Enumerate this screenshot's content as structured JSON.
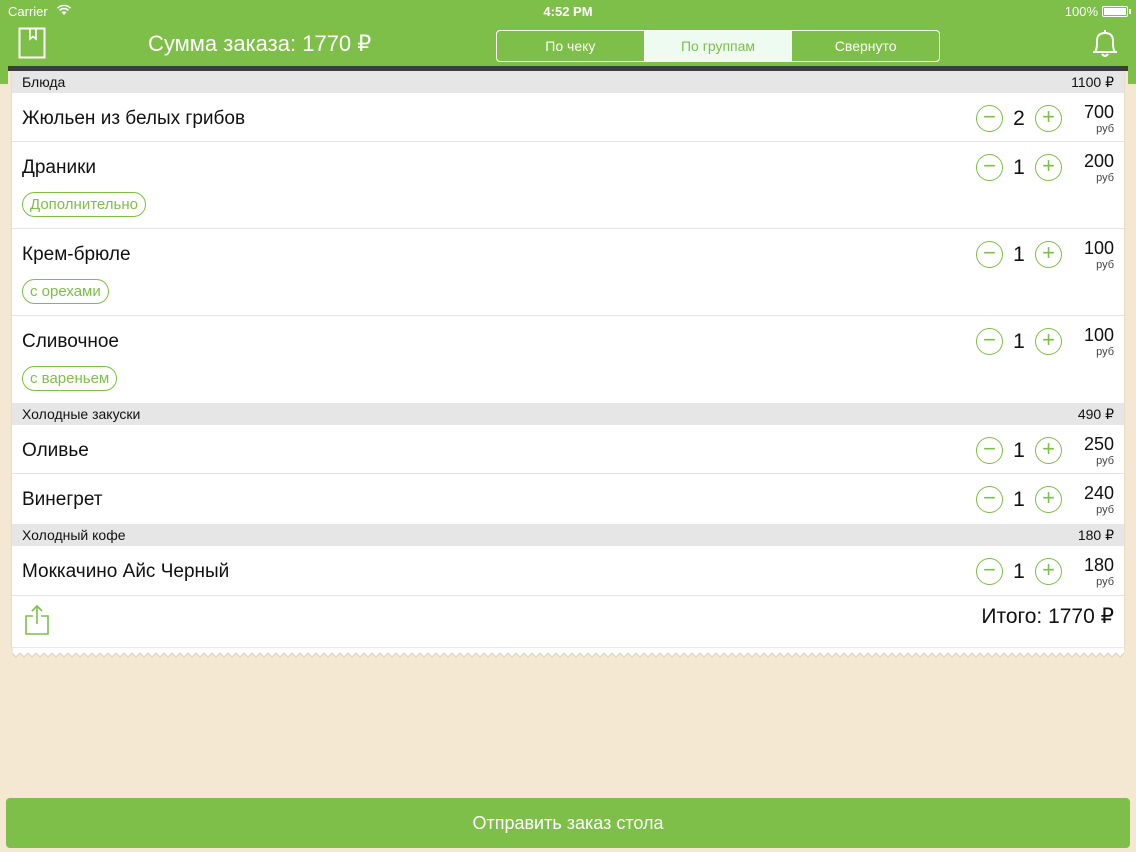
{
  "status_bar": {
    "carrier": "Carrier",
    "time": "4:52 PM",
    "battery": "100%"
  },
  "header": {
    "title": "Сумма заказа: 1770 ₽",
    "segments": [
      {
        "label": "По чеку",
        "active": false
      },
      {
        "label": "По группам",
        "active": true
      },
      {
        "label": "Свернуто",
        "active": false
      }
    ]
  },
  "groups": [
    {
      "name": "Блюда",
      "sum": "1100 ₽",
      "items": [
        {
          "name": "Жюльен из белых грибов",
          "qty": "2",
          "price": "700",
          "unit": "руб",
          "tag": ""
        },
        {
          "name": "Драники",
          "qty": "1",
          "price": "200",
          "unit": "руб",
          "tag": "Дополнительно"
        },
        {
          "name": "Крем-брюле",
          "qty": "1",
          "price": "100",
          "unit": "руб",
          "tag": "с орехами"
        },
        {
          "name": "Сливочное",
          "qty": "1",
          "price": "100",
          "unit": "руб",
          "tag": "с вареньем"
        }
      ]
    },
    {
      "name": "Холодные закуски",
      "sum": "490 ₽",
      "items": [
        {
          "name": "Оливье",
          "qty": "1",
          "price": "250",
          "unit": "руб",
          "tag": ""
        },
        {
          "name": "Винегрет",
          "qty": "1",
          "price": "240",
          "unit": "руб",
          "tag": ""
        }
      ]
    },
    {
      "name": "Холодный кофе",
      "sum": "180 ₽",
      "items": [
        {
          "name": "Моккачино Айс Черный",
          "qty": "1",
          "price": "180",
          "unit": "руб",
          "tag": ""
        }
      ]
    }
  ],
  "controls": {
    "minus": "−",
    "plus": "+"
  },
  "total": "Итого: 1770 ₽",
  "send_button": "Отправить заказ стола",
  "colors": {
    "accent": "#7dbf48",
    "background": "#f5e8d2",
    "group_header": "#e6e6e6"
  }
}
